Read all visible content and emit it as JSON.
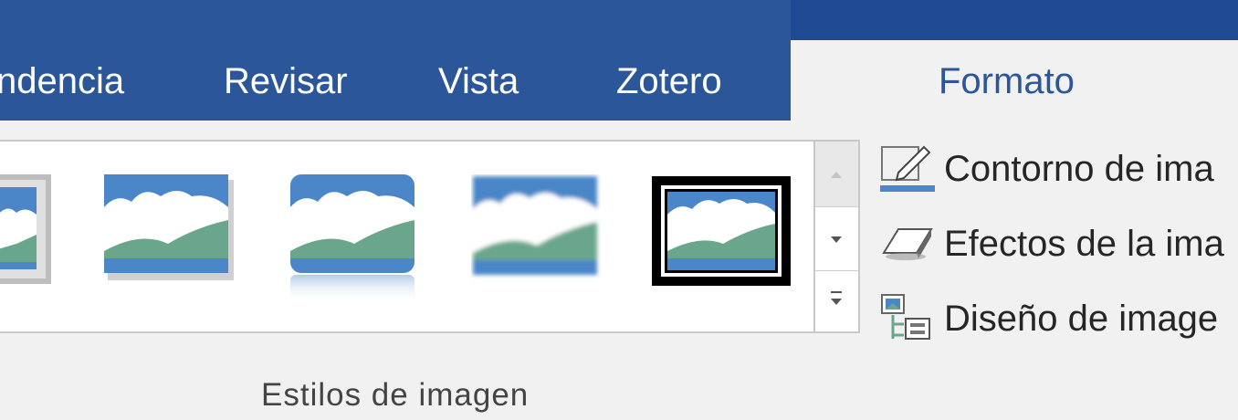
{
  "ribbon": {
    "tabs": [
      {
        "label": "ndencia"
      },
      {
        "label": "Revisar"
      },
      {
        "label": "Vista"
      },
      {
        "label": "Zotero"
      }
    ],
    "active_tab": {
      "label": "Formato"
    }
  },
  "picture_styles": {
    "group_label": "Estilos de imagen",
    "styles_count_visible": 5,
    "selected_style_index": 4
  },
  "commands": [
    {
      "label": "Contorno de ima",
      "icon": "picture-border-icon"
    },
    {
      "label": "Efectos de la ima",
      "icon": "picture-effects-icon"
    },
    {
      "label": "Diseño de image",
      "icon": "picture-layout-icon"
    }
  ],
  "colors": {
    "ribbon_blue": "#2b579a",
    "titlebar_blue": "#1e4a94",
    "sky_blue": "#4a86c8",
    "hill_green": "#6aa68c"
  }
}
